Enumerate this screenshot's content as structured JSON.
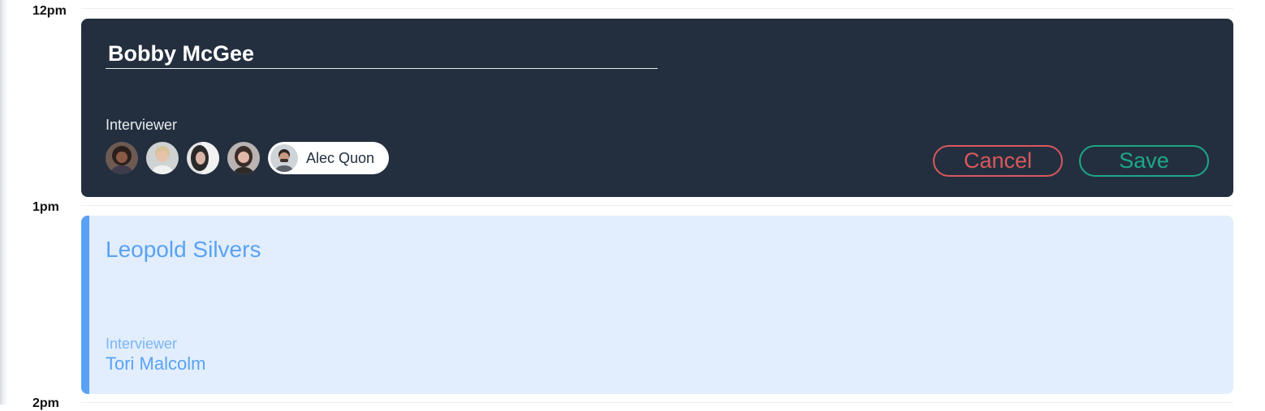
{
  "timeline": {
    "labels": [
      "12pm",
      "1pm",
      "2pm"
    ]
  },
  "edit_event": {
    "name_value": "Bobby McGee",
    "interviewer_label": "Interviewer",
    "selected_interviewer": "Alec Quon",
    "cancel_label": "Cancel",
    "save_label": "Save",
    "colors": {
      "background": "#232f3f",
      "cancel": "#d9585c",
      "save": "#1fa787"
    }
  },
  "event": {
    "title": "Leopold Silvers",
    "interviewer_label": "Interviewer",
    "interviewer_name": "Tori Malcolm",
    "colors": {
      "accent": "#59a1f4",
      "background": "#e2eefd"
    }
  }
}
